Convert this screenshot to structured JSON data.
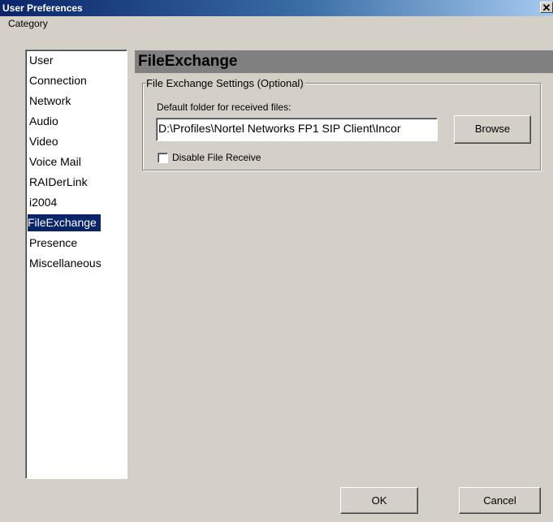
{
  "window": {
    "title": "User Preferences",
    "close_glyph": "✕"
  },
  "category": {
    "label": "Category",
    "items": [
      {
        "label": "User",
        "selected": false
      },
      {
        "label": "Connection",
        "selected": false
      },
      {
        "label": "Network",
        "selected": false
      },
      {
        "label": "Audio",
        "selected": false
      },
      {
        "label": "Video",
        "selected": false
      },
      {
        "label": "Voice Mail",
        "selected": false
      },
      {
        "label": "RAIDerLink",
        "selected": false
      },
      {
        "label": "i2004",
        "selected": false
      },
      {
        "label": "FileExchange",
        "selected": true
      },
      {
        "label": "Presence",
        "selected": false
      },
      {
        "label": "Miscellaneous",
        "selected": false
      }
    ]
  },
  "panel": {
    "title": "FileExchange",
    "group_title": "File Exchange Settings (Optional)",
    "folder_label": "Default folder for received files:",
    "folder_value": "D:\\Profiles\\Nortel Networks FP1 SIP Client\\Incor",
    "browse_label": "Browse",
    "disable_receive_label": "Disable File Receive",
    "disable_receive_checked": false
  },
  "footer": {
    "ok_label": "OK",
    "cancel_label": "Cancel"
  }
}
